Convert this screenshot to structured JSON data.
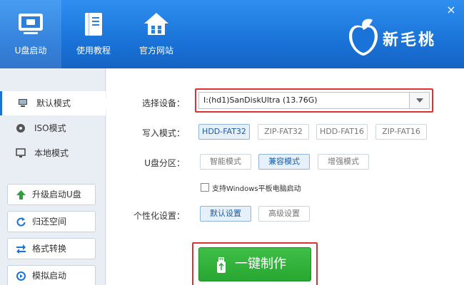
{
  "header": {
    "nav": [
      {
        "label": "U盘启动",
        "icon": "monitor-icon"
      },
      {
        "label": "使用教程",
        "icon": "book-icon"
      },
      {
        "label": "官方网站",
        "icon": "home-icon"
      }
    ],
    "close_symbol": "×",
    "logo_text": "新毛桃"
  },
  "sidebar": {
    "modes": [
      {
        "label": "默认模式",
        "icon": "computer-icon"
      },
      {
        "label": "ISO模式",
        "icon": "disc-icon"
      },
      {
        "label": "本地模式",
        "icon": "monitor-icon"
      }
    ],
    "buttons": [
      {
        "label": "升级启动U盘",
        "icon": "arrow-up-icon"
      },
      {
        "label": "归还空间",
        "icon": "refresh-icon"
      },
      {
        "label": "格式转换",
        "icon": "convert-icon"
      },
      {
        "label": "模拟启动",
        "icon": "simulate-icon"
      }
    ]
  },
  "main": {
    "device_label": "选择设备：",
    "device_value": "I:(hd1)SanDiskUltra (13.76G)",
    "write_label": "写入模式：",
    "write_options": [
      "HDD-FAT32",
      "ZIP-FAT32",
      "HDD-FAT16",
      "ZIP-FAT16"
    ],
    "partition_label": "U盘分区：",
    "partition_options": [
      "智能模式",
      "兼容模式",
      "增强模式"
    ],
    "tablet_checkbox": "支持Windows平板电脑启动",
    "personal_label": "个性化设置：",
    "personal_options": [
      "默认设置",
      "高级设置"
    ],
    "make_button": "一键制作"
  },
  "colors": {
    "header_blue": "#1a73d8",
    "highlight_red": "#e03030",
    "make_green": "#27a731"
  }
}
